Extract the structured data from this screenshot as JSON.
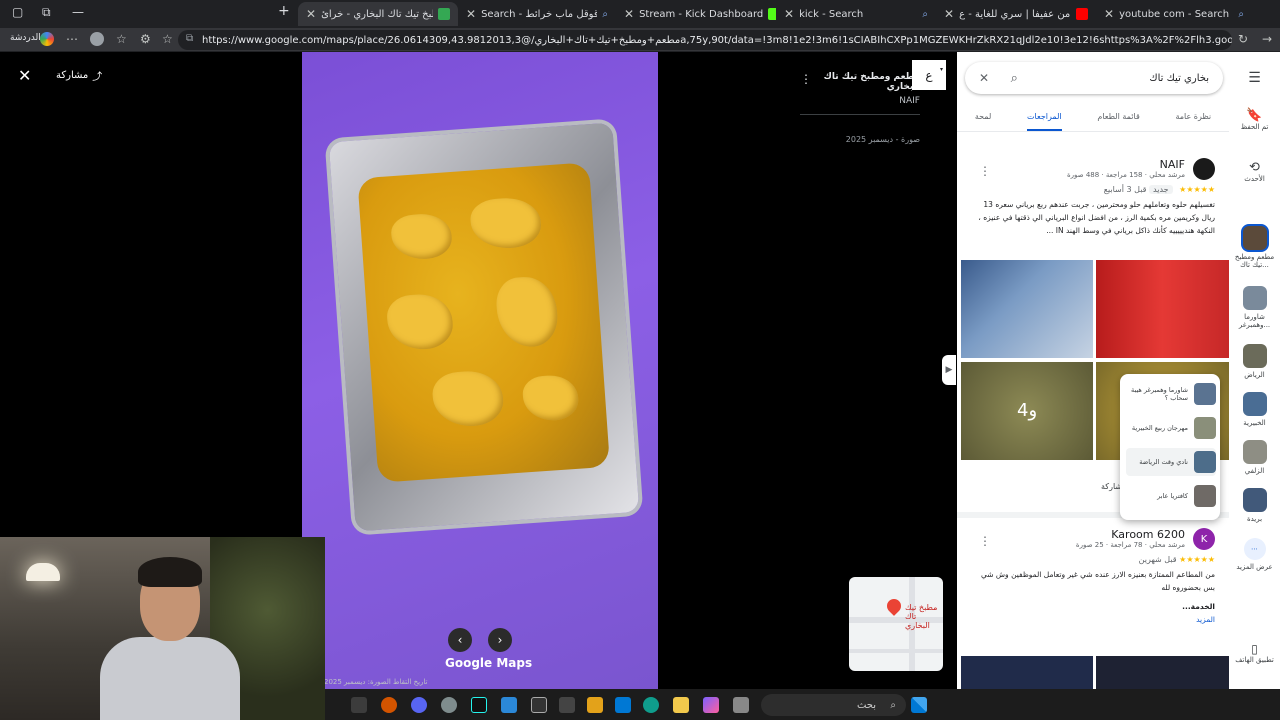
{
  "browser": {
    "tabs": [
      {
        "title": "مطعم ومطبخ تيك تاك البخاري - خرائ",
        "active": true,
        "fav_color": "#34a853"
      },
      {
        "title": "Search - قوقل ماب خرائط",
        "active": false,
        "fav_color": "#4285f4"
      },
      {
        "title": "Stream - Kick Dashboard",
        "active": false,
        "fav_color": "#53fc18"
      },
      {
        "title": "kick - Search",
        "active": false,
        "fav_color": "#53fc18"
      },
      {
        "title": "بريطاني من عفيفا | سري للغاية - ع",
        "active": false,
        "fav_color": "#ff0000"
      },
      {
        "title": "youtube com - Search",
        "active": false,
        "fav_color": "#4285f4"
      }
    ],
    "new_tab": "+",
    "url": "https://www.google.com/maps/place/مطعم+ومطبخ+تيك+تاك+البخاري/@26.0614309,43.9812013,3a,75y,90t/data=!3m8!1e2!3m6!1sCIABIhCXPp1MGZEWKHrZkRX21qJdl2e10!3e12!6shttps%3A%2F%2Flh3.googleusercontent.com%2Fgeo...",
    "profile_label": "الدردشة"
  },
  "viewer": {
    "share_label": "مشاركة",
    "poster_place": "مطعم ومطبخ تيك تاك البخاري",
    "poster_name": "NAIF",
    "photo_date": "صورة - ديسمبر 2025",
    "avatar_letter": "ع",
    "google_maps_label": "Google Maps",
    "capture_date": "تاريخ التقاط الصورة: ديسمبر 2025",
    "minimap_label": "مطبخ تيك تاك البخاري"
  },
  "panel": {
    "search_value": "بخاري تيك تاك",
    "tabs": [
      "لمحة",
      "المراجعات",
      "قائمة الطعام",
      "نظرة عامة"
    ],
    "selected_tab": "المراجعات",
    "reviews": [
      {
        "name": "NAIF",
        "meta": "مرشد محلي · 158 مراجعة · 488 صورة",
        "time": "قبل 3 أسابيع",
        "badge": "جديد",
        "stars": "★★★★★",
        "text": "تغسيلهم حلوه وتعاملهم حلو ومحترمين ، جربت عندهم ربع برياني سعره 13 ريال وكريمين مره بكمية الرز ، من افضل انواع البرياني الي ذقتها في عنيزه ، النكهة هنديييييه كأنك ذاكل برياني في وسط الهند IN ...",
        "avatar_color": "#1a1a1a",
        "avatar_letter": ""
      },
      {
        "name": "Karoom 6200",
        "meta": "مرشد محلي · 78 مراجعة · 25 صورة",
        "time": "قبل شهرين",
        "badge": "",
        "stars": "★★★★★",
        "text": "من المطاعم الممتازة بعنيزه الارز عنده شي غير وتعامل الموظفين وش شي بس بحضوروه لله",
        "more_title": "الخدمة...",
        "more_link": "المزيد",
        "avatar_color": "#8e24aa",
        "avatar_letter": "K"
      }
    ],
    "photo_overlay_text": "و4",
    "share_partial": "شاركة",
    "popup_items": [
      "شاورما وهمبرغر هيبة سحاب ؟",
      "مهرجان ربيع الخبيرية",
      "نادي وقت الرياضة",
      "كافتريا عابر"
    ]
  },
  "rail": {
    "menu_icon": "menu-icon",
    "items": [
      {
        "label": "تم الحفظ"
      },
      {
        "label": "الأحدث"
      },
      {
        "label": "مطعم ومطبخ تيك تاك..."
      },
      {
        "label": "شاورما وهمبرغر..."
      },
      {
        "label": "الرياض"
      },
      {
        "label": "الخبيرية"
      },
      {
        "label": "الزلفي"
      },
      {
        "label": "بريدة"
      },
      {
        "label": "عرض المزيد"
      },
      {
        "label": "تطبيق الهاتف"
      }
    ]
  },
  "taskbar": {
    "search_placeholder": "بحث"
  }
}
